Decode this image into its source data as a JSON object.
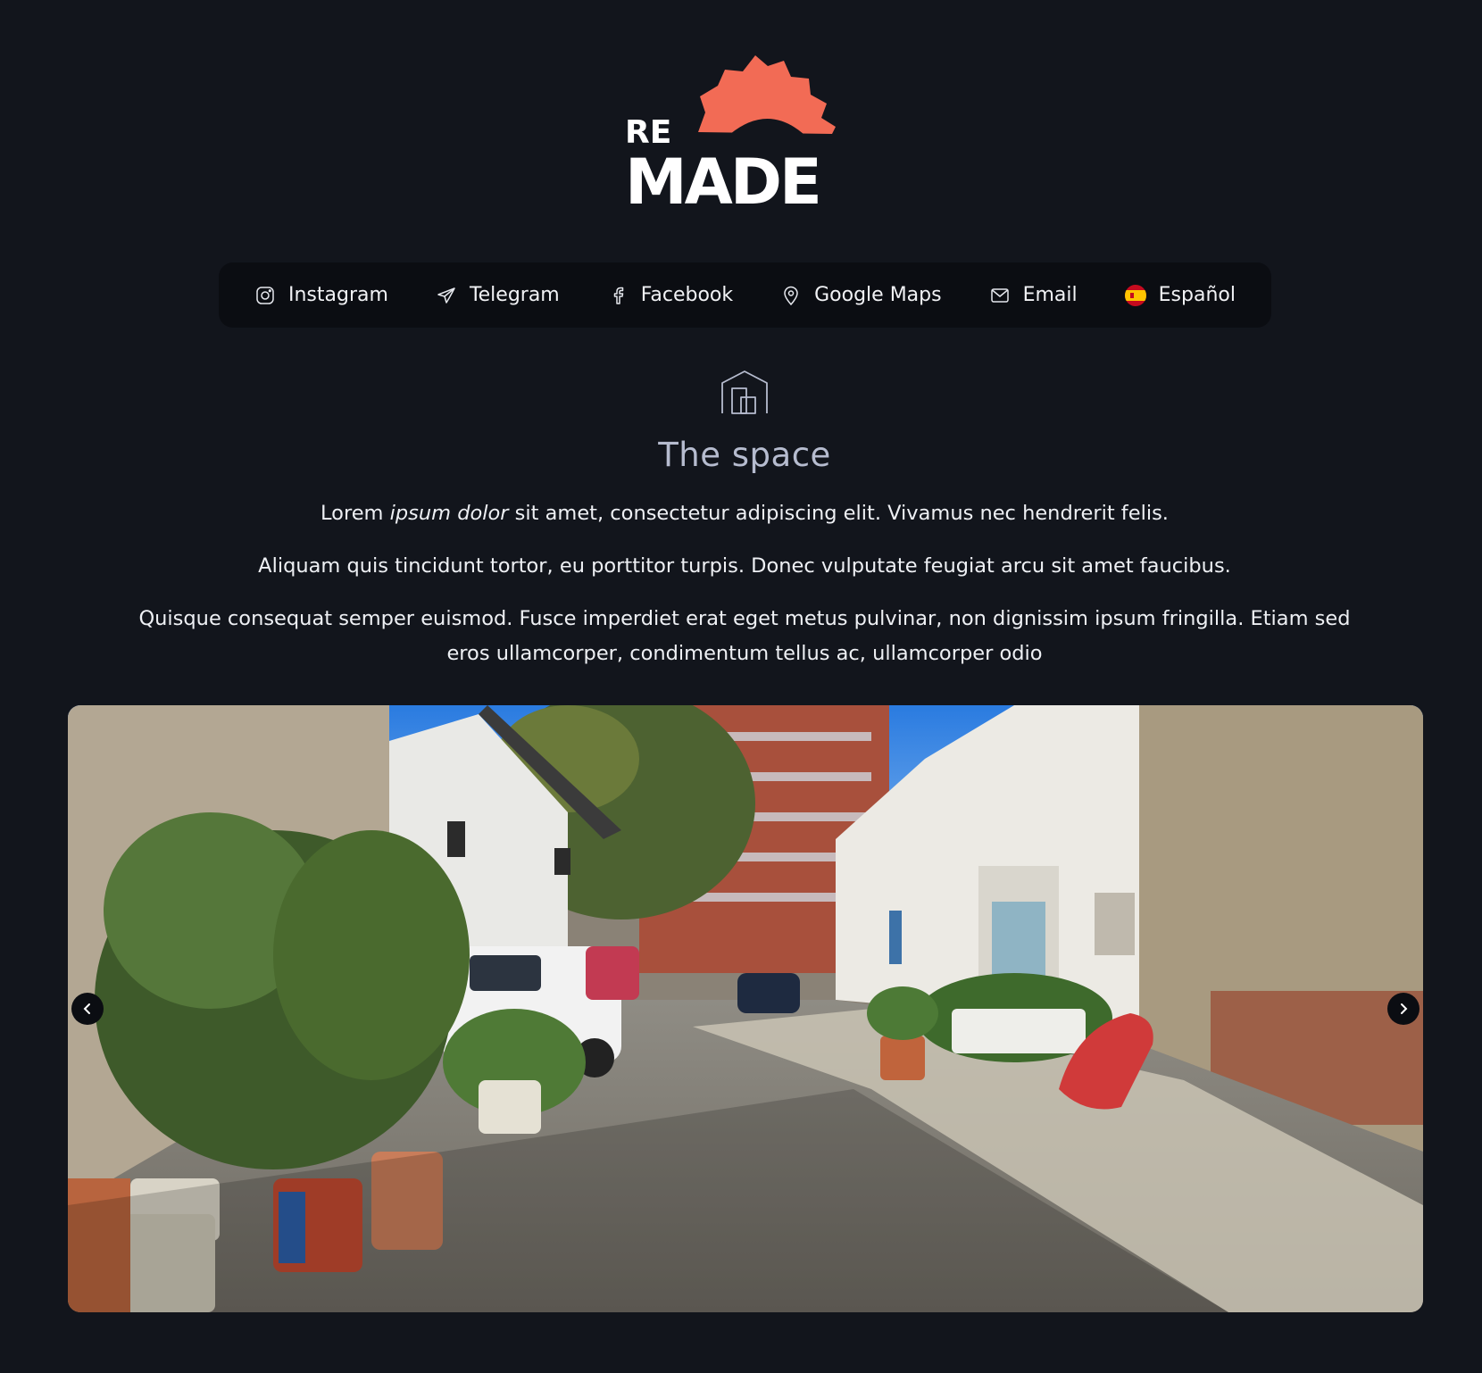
{
  "brand": {
    "logo_text": "RE MADE",
    "accent": "#f26b55"
  },
  "nav": {
    "items": [
      {
        "label": "Instagram",
        "icon": "instagram-icon"
      },
      {
        "label": "Telegram",
        "icon": "telegram-icon"
      },
      {
        "label": "Facebook",
        "icon": "facebook-icon"
      },
      {
        "label": "Google Maps",
        "icon": "map-pin-icon"
      },
      {
        "label": "Email",
        "icon": "mail-icon"
      },
      {
        "label": "Español",
        "icon": "spain-flag-icon"
      }
    ]
  },
  "section": {
    "icon": "building-icon",
    "title": "The space",
    "p1_a": "Lorem ",
    "p1_em": "ipsum dolor",
    "p1_b": " sit amet, consectetur adipiscing elit. Vivamus nec hendrerit felis.",
    "p2": "Aliquam quis tincidunt tortor, eu porttitor turpis. Donec vulputate feugiat arcu sit amet faucibus.",
    "p3": "Quisque consequat semper euismod. Fusce imperdiet erat eget metus pulvinar, non dignissim ipsum fringilla. Etiam sed eros ullamcorper, condimentum tellus ac, ullamcorper odio"
  },
  "carousel": {
    "prev_icon": "chevron-left-icon",
    "next_icon": "chevron-right-icon"
  }
}
